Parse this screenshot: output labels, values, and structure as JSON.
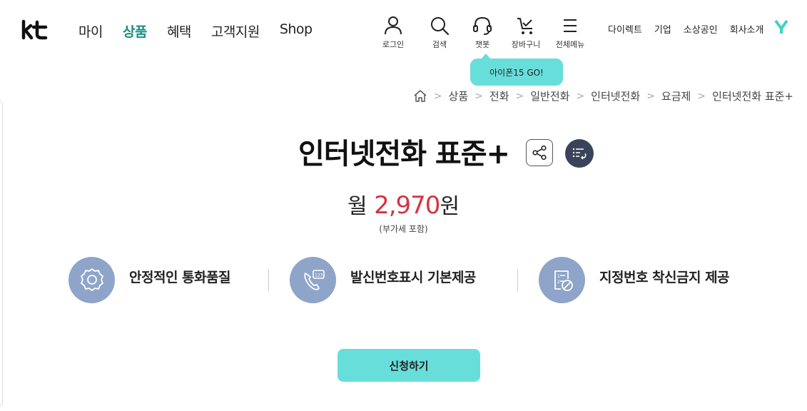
{
  "brand": {
    "logo_text": "kt"
  },
  "gnb": [
    {
      "label": "마이"
    },
    {
      "label": "상품",
      "active": true
    },
    {
      "label": "혜택"
    },
    {
      "label": "고객지원"
    },
    {
      "label": "Shop"
    }
  ],
  "utility": {
    "login": {
      "label": "로그인",
      "icon": "user-icon"
    },
    "search": {
      "label": "검색",
      "icon": "search-icon"
    },
    "chatbot": {
      "label": "챗봇",
      "icon": "headset-icon"
    },
    "cart": {
      "label": "장바구니",
      "icon": "cart-icon"
    },
    "menu": {
      "label": "전체메뉴",
      "icon": "menu-icon"
    }
  },
  "toplinks": [
    "다이렉트",
    "기업",
    "소상공인",
    "회사소개"
  ],
  "tooltip": "아이폰15 GO!",
  "breadcrumb": [
    "상품",
    "전화",
    "일반전화",
    "인터넷전화",
    "요금제",
    "인터넷전화 표준+"
  ],
  "product": {
    "title": "인터넷전화 표준+",
    "price_prefix": "월",
    "price_value": "2,970",
    "price_unit": "원",
    "vat_note": "(부가세 포함)"
  },
  "features": [
    {
      "text": "안정적인 통화품질",
      "icon": "quality-badge-icon"
    },
    {
      "text": "발신번호표시 기본제공",
      "icon": "caller-id-icon"
    },
    {
      "text": "지정번호 착신금지 제공",
      "icon": "block-number-icon"
    }
  ],
  "apply_button": "신청하기",
  "colors": {
    "accent": "#68dedb",
    "active_menu": "#1b8f7e",
    "price": "#d63342",
    "feature_circle": "#8ea4c8",
    "dark_button": "#3a4359"
  }
}
